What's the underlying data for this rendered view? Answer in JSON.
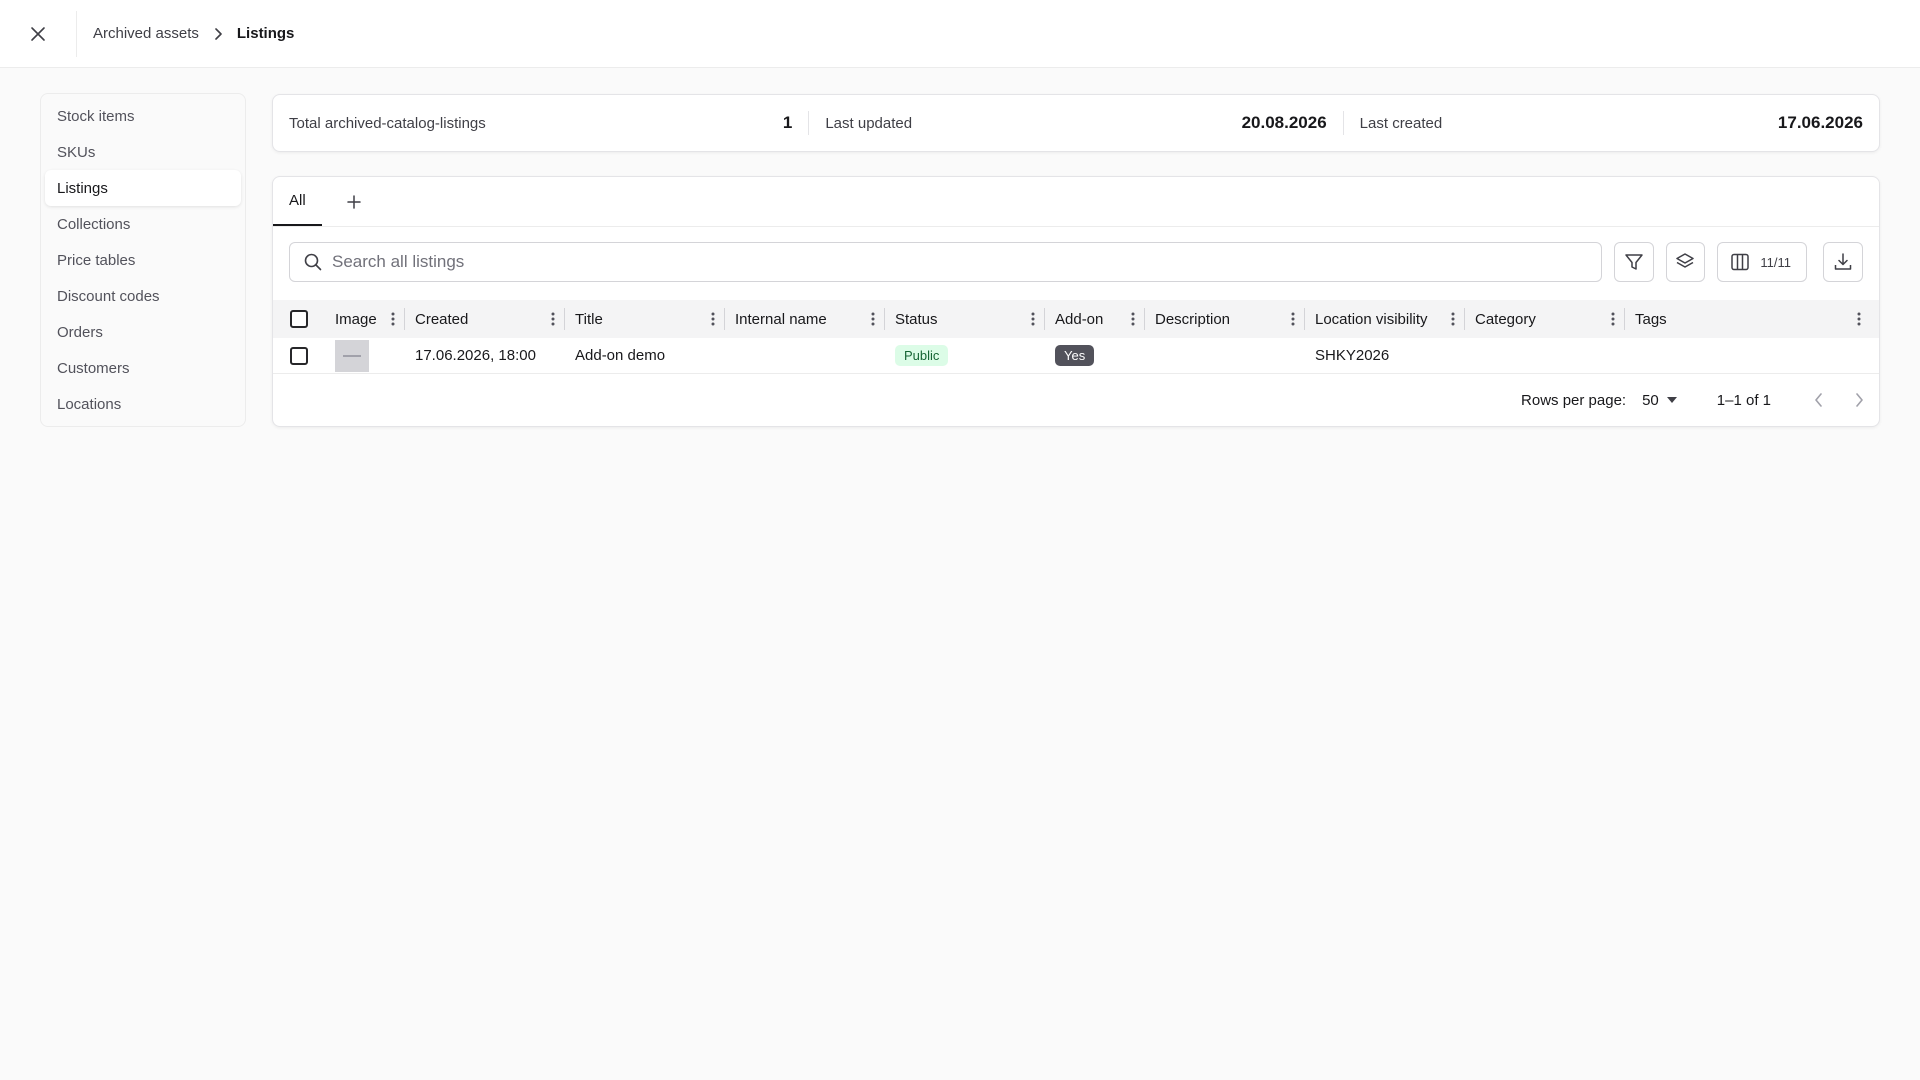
{
  "topbar": {
    "breadcrumb": [
      "Archived assets",
      "Listings"
    ]
  },
  "sidebar": {
    "items": [
      {
        "label": "Stock items",
        "active": false
      },
      {
        "label": "SKUs",
        "active": false
      },
      {
        "label": "Listings",
        "active": true
      },
      {
        "label": "Collections",
        "active": false
      },
      {
        "label": "Price tables",
        "active": false
      },
      {
        "label": "Discount codes",
        "active": false
      },
      {
        "label": "Orders",
        "active": false
      },
      {
        "label": "Customers",
        "active": false
      },
      {
        "label": "Locations",
        "active": false
      }
    ]
  },
  "stats": {
    "total_label": "Total archived-catalog-listings",
    "total_value": "1",
    "updated_label": "Last updated",
    "updated_value": "20.08.2026",
    "created_label": "Last created",
    "created_value": "17.06.2026"
  },
  "tabs": [
    {
      "label": "All",
      "active": true
    }
  ],
  "toolbar": {
    "search_placeholder": "Search all listings",
    "columns_count": "11/11"
  },
  "table": {
    "columns": [
      "Image",
      "Created",
      "Title",
      "Internal name",
      "Status",
      "Add-on",
      "Description",
      "Location visibility",
      "Category",
      "Tags"
    ],
    "rows": [
      {
        "created": "17.06.2026, 18:00",
        "title": "Add-on demo",
        "internal_name": "",
        "status": "Public",
        "addon": "Yes",
        "description": "",
        "location_visibility": "SHKY2026",
        "category": "",
        "tags": ""
      }
    ]
  },
  "pagination": {
    "rows_per_page_label": "Rows per page:",
    "rows_per_page_value": "50",
    "range": "1–1 of 1"
  },
  "colors": {
    "status_public_bg": "#dcfce7",
    "status_public_fg": "#166534",
    "addon_yes_bg": "#52525b"
  }
}
